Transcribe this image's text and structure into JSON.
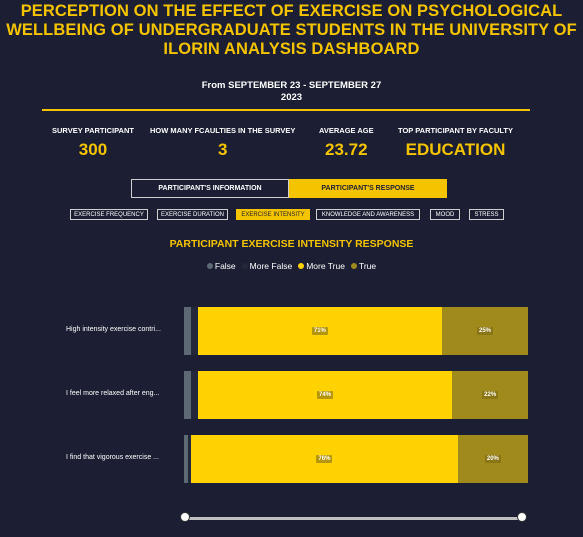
{
  "header": {
    "title": "PERCEPTION ON THE EFFECT OF EXERCISE ON PSYCHOLOGICAL WELLBEING OF UNDERGRADUATE STUDENTS IN THE UNIVERSITY OF ILORIN ANALYSIS DASHBOARD",
    "subtitle_line1": "From SEPTEMBER 23 - SEPTEMBER 27",
    "subtitle_line2": "2023"
  },
  "kpis": [
    {
      "label": "SURVEY PARTICIPANT",
      "value": "300"
    },
    {
      "label": "HOW MANY FCAULTIES IN THE SURVEY",
      "value": "3"
    },
    {
      "label": "AVERAGE AGE",
      "value": "23.72"
    },
    {
      "label": "TOP PARTICIPANT BY FACULTY",
      "value": "EDUCATION"
    }
  ],
  "toggle": {
    "left": "PARTICIPANT'S INFORMATION",
    "right": "PARTICIPANT'S RESPONSE",
    "active": "right"
  },
  "tabs": [
    {
      "label": "EXERCISE FREQUENCY",
      "active": false
    },
    {
      "label": "EXERCISE DURATION",
      "active": false
    },
    {
      "label": "EXERCISE INTENSITY",
      "active": true
    },
    {
      "label": "KNOWLEDGE AND AWARENESS",
      "active": false
    },
    {
      "label": "MOOD",
      "active": false
    },
    {
      "label": "STRESS",
      "active": false
    }
  ],
  "colors": {
    "accent": "#f5c400",
    "background": "#1c1f33",
    "false": "#5d6a73",
    "more_false": "#23273a",
    "more_true": "#ffd200",
    "true": "#a08a1c"
  },
  "chart_data": {
    "type": "bar",
    "orientation": "horizontal-stacked-100",
    "title": "PARTICIPANT EXERCISE INTENSITY RESPONSE",
    "categories": [
      "High intensity exercise contri...",
      "I feel more relaxed after eng...",
      "I find that vigorous exercise ..."
    ],
    "series": [
      {
        "name": "False",
        "color": "#5d6a73",
        "values": [
          2,
          2,
          1
        ]
      },
      {
        "name": "More False",
        "color": "#23273a",
        "values": [
          2,
          2,
          1
        ]
      },
      {
        "name": "More True",
        "color": "#ffd200",
        "values": [
          71,
          74,
          76
        ]
      },
      {
        "name": "True",
        "color": "#a08a1c",
        "values": [
          25,
          22,
          20
        ]
      }
    ],
    "data_labels": [
      {
        "series": "More True",
        "labels": [
          "71%",
          "74%",
          "76%"
        ]
      },
      {
        "series": "True",
        "labels": [
          "25%",
          "22%",
          "20%"
        ]
      }
    ],
    "legend_position": "top-center",
    "grid": false
  }
}
